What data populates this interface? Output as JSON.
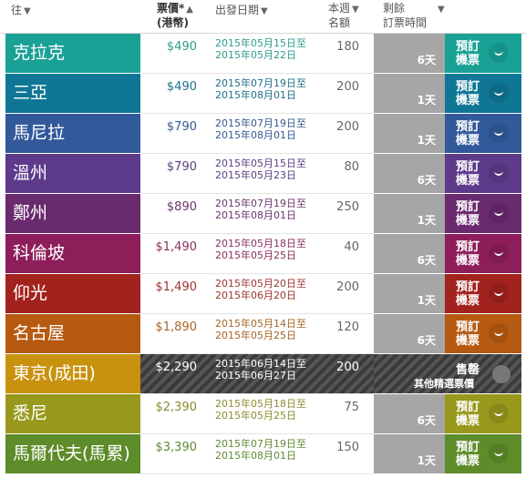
{
  "header": {
    "to": "往",
    "price_line1": "票價*",
    "price_line2": "(港幣)",
    "depart": "出發日期",
    "seats_line1": "本週",
    "seats_line2": "名額",
    "remain_line1": "剩餘",
    "remain_line2": "訂票時間"
  },
  "rows": [
    {
      "dest": "克拉克",
      "price": "$490",
      "d1": "2015年05月15日至",
      "d2": "2015年05月22日",
      "seats": "180",
      "left": "6天",
      "book": [
        "預訂",
        "機票"
      ],
      "c1": "#1aa195",
      "c2": "#169388",
      "text": "#2f9a8c"
    },
    {
      "dest": "三亞",
      "price": "$490",
      "d1": "2015年07月19日至",
      "d2": "2015年08月01日",
      "seats": "200",
      "left": "1天",
      "book": [
        "預訂",
        "機票"
      ],
      "c1": "#0f7795",
      "c2": "#0d6b86",
      "text": "#1f6f89"
    },
    {
      "dest": "馬尼拉",
      "price": "$790",
      "d1": "2015年07月19日至",
      "d2": "2015年08月01日",
      "seats": "200",
      "left": "1天",
      "book": [
        "預訂",
        "機票"
      ],
      "c1": "#325a9b",
      "c2": "#2d518c",
      "text": "#35598f"
    },
    {
      "dest": "溫州",
      "price": "$790",
      "d1": "2015年05月15日至",
      "d2": "2015年05月23日",
      "seats": "80",
      "left": "6天",
      "book": [
        "預訂",
        "機票"
      ],
      "c1": "#5d3b8a",
      "c2": "#54357c",
      "text": "#5c4183"
    },
    {
      "dest": "鄭州",
      "price": "$890",
      "d1": "2015年07月19日至",
      "d2": "2015年08月01日",
      "seats": "250",
      "left": "1天",
      "book": [
        "預訂",
        "機票"
      ],
      "c1": "#6a2a6e",
      "c2": "#5f2563",
      "text": "#6a356b"
    },
    {
      "dest": "科倫坡",
      "price": "$1,490",
      "d1": "2015年05月18日至",
      "d2": "2015年05月25日",
      "seats": "40",
      "left": "6天",
      "book": [
        "預訂",
        "機票"
      ],
      "c1": "#8d1e5a",
      "c2": "#7f1b51",
      "text": "#8a3060"
    },
    {
      "dest": "仰光",
      "price": "$1,490",
      "d1": "2015年05月20日至",
      "d2": "2015年06月20日",
      "seats": "200",
      "left": "1天",
      "book": [
        "預訂",
        "機票"
      ],
      "c1": "#a2221e",
      "c2": "#921e1b",
      "text": "#9a3431"
    },
    {
      "dest": "名古屋",
      "price": "$1,890",
      "d1": "2015年05月14日至",
      "d2": "2015年05月25日",
      "seats": "120",
      "left": "6天",
      "book": [
        "預訂",
        "機票"
      ],
      "c1": "#b65a12",
      "c2": "#a45110",
      "text": "#a86327"
    },
    {
      "dest": "東京(成田)",
      "price": "$2,290",
      "d1": "2015年06月14日至",
      "d2": "2015年06月27日",
      "seats": "200",
      "sold": true,
      "sold1": "售罄",
      "sold2": "其他精選票價",
      "c1": "#c8920f",
      "c2": "#b4840e",
      "text": "#ffffff"
    },
    {
      "dest": "悉尼",
      "price": "$2,390",
      "d1": "2015年05月18日至",
      "d2": "2015年05月25日",
      "seats": "75",
      "left": "6天",
      "book": [
        "預訂",
        "機票"
      ],
      "c1": "#98981c",
      "c2": "#898919",
      "text": "#8c8c2e"
    },
    {
      "dest": "馬爾代夫(馬累)",
      "price": "$3,390",
      "d1": "2015年07月19日至",
      "d2": "2015年08月01日",
      "seats": "150",
      "left": "1天",
      "book": [
        "預訂",
        "機票"
      ],
      "c1": "#5e8c2a",
      "c2": "#557e26",
      "text": "#5f8836"
    }
  ]
}
